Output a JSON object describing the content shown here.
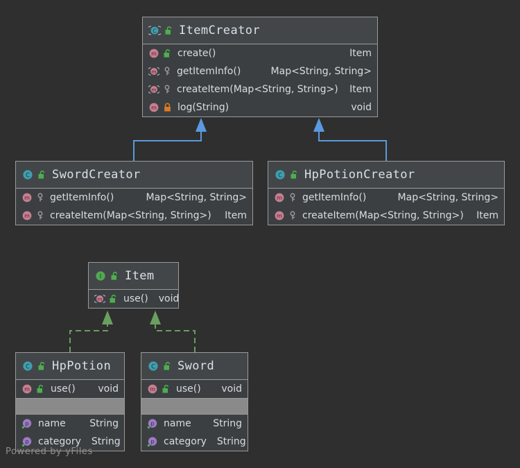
{
  "canvas": {
    "background": "#2f2f2f",
    "watermark": "Powered by yFiles"
  },
  "colors": {
    "node_border": "#9a9a9a",
    "node_header_bg": "#434648",
    "node_body_bg": "#3c3f41",
    "text": "#d8dde3",
    "title_text": "#d8e0ea",
    "inheritance_edge": "#5a9ae0",
    "realization_edge": "#6a9f60",
    "class_icon": "#3f9fb0",
    "interface_icon": "#52a852",
    "method_icon": "#c77f90",
    "property_icon": "#9b7bc4",
    "lock_public": "#4caf50",
    "lock_private": "#d97b26",
    "key_protected": "#9a9a9a",
    "separator_band": "#8a8a8a"
  },
  "nodes": {
    "item_creator": {
      "title": "ItemCreator",
      "stereotype_icon": "abstract-class-icon",
      "visibility_icon": "lock-open-public-icon",
      "members": [
        {
          "icon": "method-icon",
          "visibility_icon": "lock-open-public-icon",
          "name": "create()",
          "type": "Item"
        },
        {
          "icon": "abstract-method-icon",
          "visibility_icon": "key-protected-icon",
          "name": "getItemInfo()",
          "type": "Map<String, String>"
        },
        {
          "icon": "abstract-method-icon",
          "visibility_icon": "key-protected-icon",
          "name": "createItem(Map<String, String>)",
          "type": "Item"
        },
        {
          "icon": "method-icon",
          "visibility_icon": "lock-closed-private-icon",
          "name": "log(String)",
          "type": "void"
        }
      ]
    },
    "sword_creator": {
      "title": "SwordCreator",
      "stereotype_icon": "class-icon",
      "visibility_icon": "lock-open-public-icon",
      "members": [
        {
          "icon": "method-icon",
          "visibility_icon": "key-protected-icon",
          "name": "getItemInfo()",
          "type": "Map<String, String>"
        },
        {
          "icon": "method-icon",
          "visibility_icon": "key-protected-icon",
          "name": "createItem(Map<String, String>)",
          "type": "Item"
        }
      ]
    },
    "hp_potion_creator": {
      "title": "HpPotionCreator",
      "stereotype_icon": "class-icon",
      "visibility_icon": "lock-open-public-icon",
      "members": [
        {
          "icon": "method-icon",
          "visibility_icon": "key-protected-icon",
          "name": "getItemInfo()",
          "type": "Map<String, String>"
        },
        {
          "icon": "method-icon",
          "visibility_icon": "key-protected-icon",
          "name": "createItem(Map<String, String>)",
          "type": "Item"
        }
      ]
    },
    "item": {
      "title": "Item",
      "stereotype_icon": "interface-icon",
      "visibility_icon": "lock-open-public-icon",
      "members": [
        {
          "icon": "abstract-method-icon",
          "visibility_icon": "lock-open-public-icon",
          "name": "use()",
          "type": "void"
        }
      ]
    },
    "hp_potion": {
      "title": "HpPotion",
      "stereotype_icon": "class-icon",
      "visibility_icon": "lock-open-public-icon",
      "methods": [
        {
          "icon": "method-icon",
          "visibility_icon": "lock-open-public-icon",
          "name": "use()",
          "type": "void"
        }
      ],
      "fields": [
        {
          "icon": "property-icon",
          "name": "name",
          "type": "String"
        },
        {
          "icon": "property-icon",
          "name": "category",
          "type": "String"
        }
      ]
    },
    "sword": {
      "title": "Sword",
      "stereotype_icon": "class-icon",
      "visibility_icon": "lock-open-public-icon",
      "methods": [
        {
          "icon": "method-icon",
          "visibility_icon": "lock-open-public-icon",
          "name": "use()",
          "type": "void"
        }
      ],
      "fields": [
        {
          "icon": "property-icon",
          "name": "name",
          "type": "String"
        },
        {
          "icon": "property-icon",
          "name": "category",
          "type": "String"
        }
      ]
    }
  },
  "edges": [
    {
      "from": "SwordCreator",
      "to": "ItemCreator",
      "type": "inheritance"
    },
    {
      "from": "HpPotionCreator",
      "to": "ItemCreator",
      "type": "inheritance"
    },
    {
      "from": "HpPotion",
      "to": "Item",
      "type": "realization"
    },
    {
      "from": "Sword",
      "to": "Item",
      "type": "realization"
    }
  ]
}
